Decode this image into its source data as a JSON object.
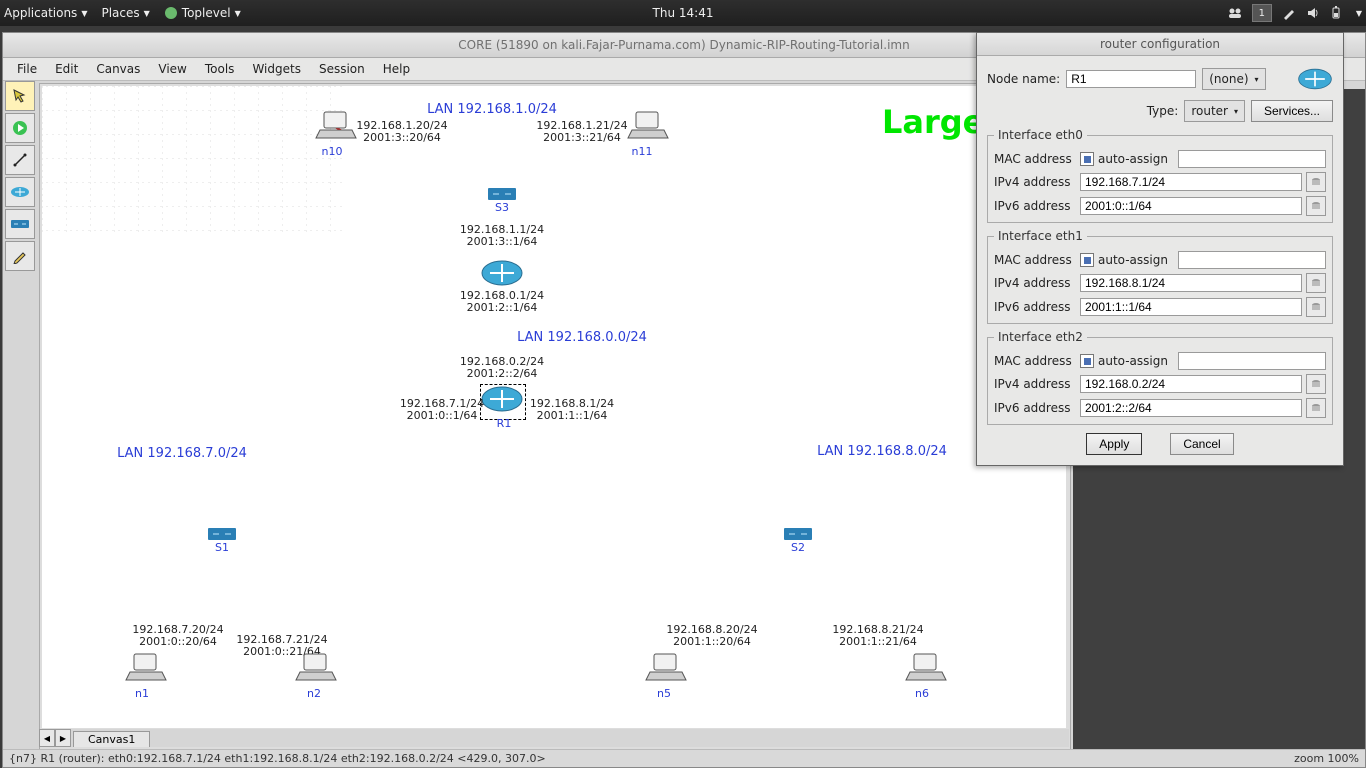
{
  "topbar": {
    "apps": "Applications",
    "places": "Places",
    "toplevel": "Toplevel",
    "clock": "Thu 14:41",
    "wsnum": "1"
  },
  "app": {
    "title": "CORE (51890 on kali.Fajar-Purnama.com) Dynamic-RIP-Routing-Tutorial.imn",
    "menus": [
      "File",
      "Edit",
      "Canvas",
      "View",
      "Tools",
      "Widgets",
      "Session",
      "Help"
    ],
    "canvas_tab": "Canvas1",
    "status": "{n7} R1 (router): eth0:192.168.7.1/24 eth1:192.168.8.1/24 eth2:192.168.0.2/24 <429.0, 307.0>",
    "zoom": "zoom 100%"
  },
  "labels": {
    "wan": "Larger WAN",
    "lan1": "LAN 192.168.1.0/24",
    "lan0": "LAN 192.168.0.0/24",
    "lan7": "LAN 192.168.7.0/24",
    "lan8": "LAN 192.168.8.0/24",
    "n10": "n10",
    "n11": "n11",
    "n1": "n1",
    "n2": "n2",
    "n5": "n5",
    "n6": "n6",
    "s3": "S3",
    "s1": "S1",
    "s2": "S2",
    "r1": "R1",
    "n10_ip": "192.168.1.20/24\n2001:3::20/64",
    "n11_ip": "192.168.1.21/24\n2001:3::21/64",
    "s3down": "192.168.1.1/24\n2001:3::1/64",
    "r2top": "192.168.0.1/24\n2001:2::1/64",
    "r1top": "192.168.0.2/24\n2001:2::2/64",
    "r1left": "192.168.7.1/24\n2001:0::1/64",
    "r1right": "192.168.8.1/24\n2001:1::1/64",
    "n1_ip": "192.168.7.20/24\n2001:0::20/64",
    "n2_ip": "192.168.7.21/24\n2001:0::21/64",
    "n5_ip": "192.168.8.20/24\n2001:1::20/64",
    "n6_ip": "192.168.8.21/24\n2001:1::21/64"
  },
  "dialog": {
    "title": "router configuration",
    "nodename_lbl": "Node name:",
    "nodename": "R1",
    "none": "(none)",
    "type_lbl": "Type:",
    "type": "router",
    "services": "Services...",
    "if0": {
      "legend": "Interface eth0",
      "mac_lbl": "MAC address",
      "auto": "auto-assign",
      "mac": "",
      "v4l": "IPv4 address",
      "v4": "192.168.7.1/24",
      "v6l": "IPv6 address",
      "v6": "2001:0::1/64"
    },
    "if1": {
      "legend": "Interface eth1",
      "mac_lbl": "MAC address",
      "auto": "auto-assign",
      "mac": "",
      "v4l": "IPv4 address",
      "v4": "192.168.8.1/24",
      "v6l": "IPv6 address",
      "v6": "2001:1::1/64"
    },
    "if2": {
      "legend": "Interface eth2",
      "mac_lbl": "MAC address",
      "auto": "auto-assign",
      "mac": "",
      "v4l": "IPv4 address",
      "v4": "192.168.0.2/24",
      "v6l": "IPv6 address",
      "v6": "2001:2::2/64"
    },
    "apply": "Apply",
    "cancel": "Cancel"
  }
}
